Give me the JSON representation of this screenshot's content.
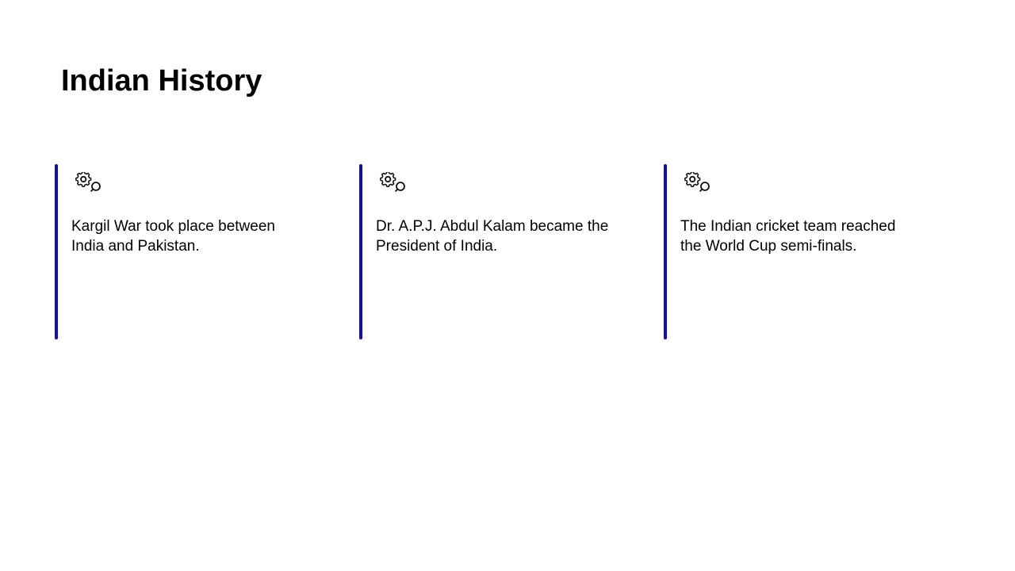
{
  "title": "Indian History",
  "colors": {
    "accent": "#0a0ad2",
    "text": "#000000",
    "background": "#ffffff"
  },
  "cards": [
    {
      "icon": "gear-icon",
      "text": "Kargil War took place between India and Pakistan."
    },
    {
      "icon": "gear-icon",
      "text": "Dr. A.P.J. Abdul Kalam became the President of India."
    },
    {
      "icon": "gear-icon",
      "text": "The Indian cricket team reached the World Cup semi-finals."
    }
  ]
}
